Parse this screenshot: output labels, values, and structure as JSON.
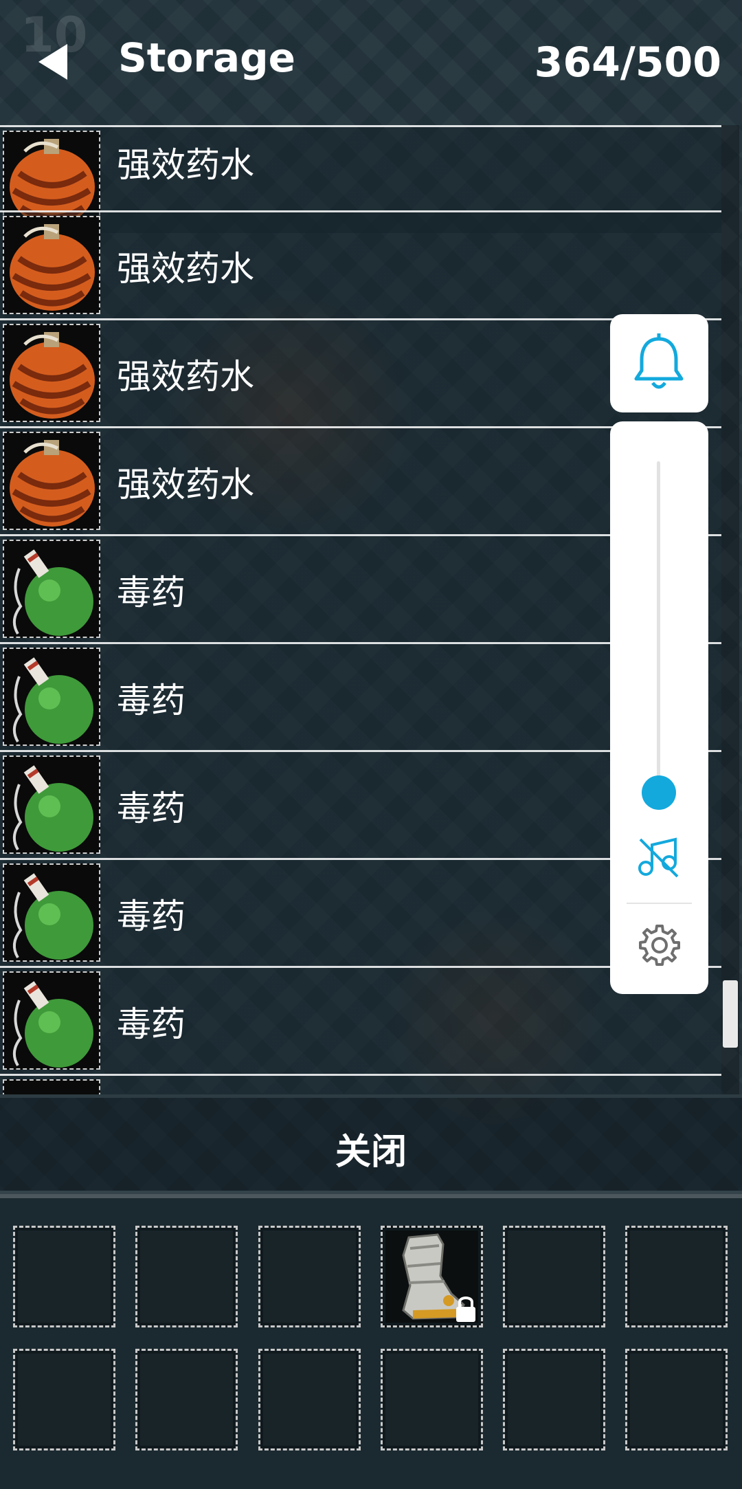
{
  "header": {
    "title": "Storage",
    "count": "364/500"
  },
  "items": [
    {
      "label": "强效药水",
      "icon": "orange-potion-icon"
    },
    {
      "label": "强效药水",
      "icon": "orange-potion-icon"
    },
    {
      "label": "强效药水",
      "icon": "orange-potion-icon"
    },
    {
      "label": "强效药水",
      "icon": "orange-potion-icon"
    },
    {
      "label": "毒药",
      "icon": "green-poison-flask-icon"
    },
    {
      "label": "毒药",
      "icon": "green-poison-flask-icon"
    },
    {
      "label": "毒药",
      "icon": "green-poison-flask-icon"
    },
    {
      "label": "毒药",
      "icon": "green-poison-flask-icon"
    },
    {
      "label": "毒药",
      "icon": "green-poison-flask-icon"
    }
  ],
  "floating_controls": {
    "bell_icon": "bell-icon",
    "volume_level": 0.07,
    "mute_icon": "music-off-icon",
    "settings_icon": "gear-icon",
    "accent_color": "#13a9dd"
  },
  "close_bar": {
    "label": "关闭"
  },
  "inventory": {
    "slot_count": 12,
    "occupied": [
      {
        "slot": 4,
        "icon": "boot-icon",
        "locked": true
      }
    ]
  }
}
